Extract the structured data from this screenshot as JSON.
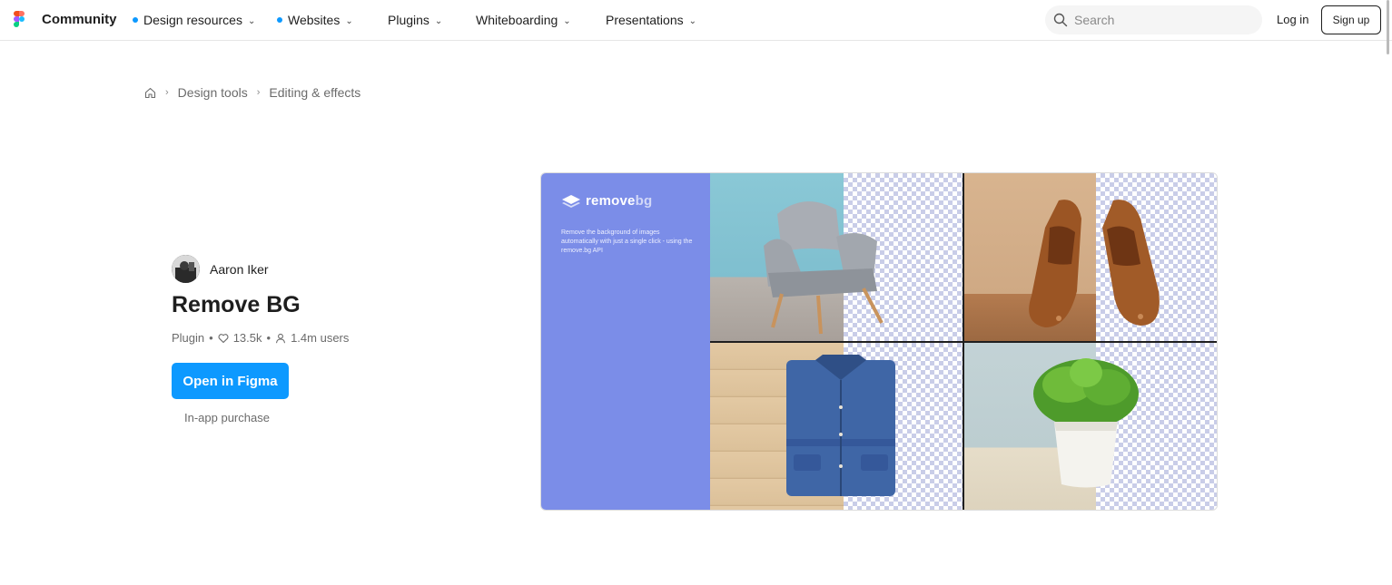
{
  "header": {
    "brand": "Community",
    "nav": [
      {
        "label": "Design resources",
        "dot": true
      },
      {
        "label": "Websites",
        "dot": true
      },
      {
        "label": "Plugins",
        "dot": false
      },
      {
        "label": "Whiteboarding",
        "dot": false
      },
      {
        "label": "Presentations",
        "dot": false
      }
    ],
    "search_placeholder": "Search",
    "login_label": "Log in",
    "signup_label": "Sign up"
  },
  "breadcrumb": [
    "Design tools",
    "Editing & effects"
  ],
  "plugin": {
    "author": "Aaron Iker",
    "title": "Remove BG",
    "type": "Plugin",
    "likes": "13.5k",
    "users": "1.4m users",
    "open_label": "Open in Figma",
    "purchase_note": "In-app purchase"
  },
  "preview": {
    "logo_word_a": "remove",
    "logo_word_b": "bg",
    "description": "Remove the background of images automatically with just a single click - using the remove.bg API"
  },
  "colors": {
    "accent": "#0d99ff",
    "preview_panel": "#7b8de8"
  },
  "icons": [
    "figma-logo-icon",
    "chevron-down-icon",
    "search-icon",
    "home-icon",
    "chevron-right-icon",
    "heart-icon",
    "user-icon",
    "removebg-logo-icon"
  ]
}
